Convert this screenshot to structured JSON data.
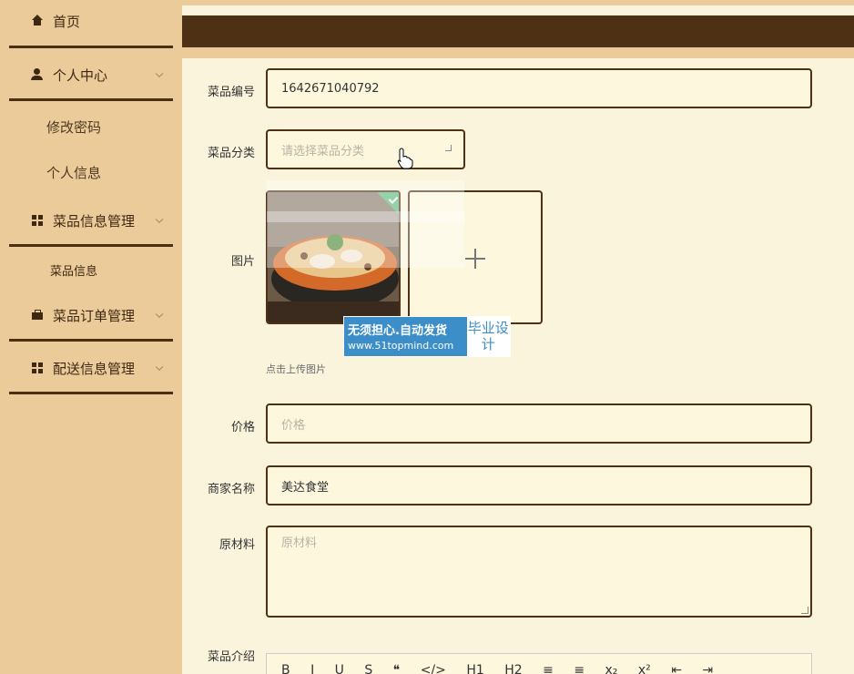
{
  "sidebar": {
    "home": "首页",
    "personal_center": "个人中心",
    "change_password": "修改密码",
    "personal_info": "个人信息",
    "dish_info_mgmt": "菜品信息管理",
    "dish_info": "菜品信息",
    "dish_order_mgmt": "菜品订单管理",
    "delivery_mgmt": "配送信息管理"
  },
  "form": {
    "dish_code_label": "菜品编号",
    "dish_code_value": "1642671040792",
    "category_label": "菜品分类",
    "category_placeholder": "请选择菜品分类",
    "image_label": "图片",
    "upload_hint": "点击上传图片",
    "price_label": "价格",
    "price_placeholder": "价格",
    "merchant_label": "商家名称",
    "merchant_value": "美达食堂",
    "material_label": "原材料",
    "material_placeholder": "原材料",
    "intro_label": "菜品介绍"
  },
  "watermark": {
    "line1": "无须担心.自动发货",
    "line2": "www.51topmind.com",
    "right": "毕业设计"
  },
  "editor_toolbar": [
    "B",
    "I",
    "U",
    "S",
    "❝",
    "</>",
    "H1",
    "H2",
    "≡",
    "≡",
    "x₂",
    "x²",
    "⇤",
    "⇥"
  ],
  "colors": {
    "sidebar_bg": "#eccb9a",
    "topbar_bg": "#4e3114",
    "content_bg": "#fbf4dc",
    "field_border": "#4e3114"
  }
}
